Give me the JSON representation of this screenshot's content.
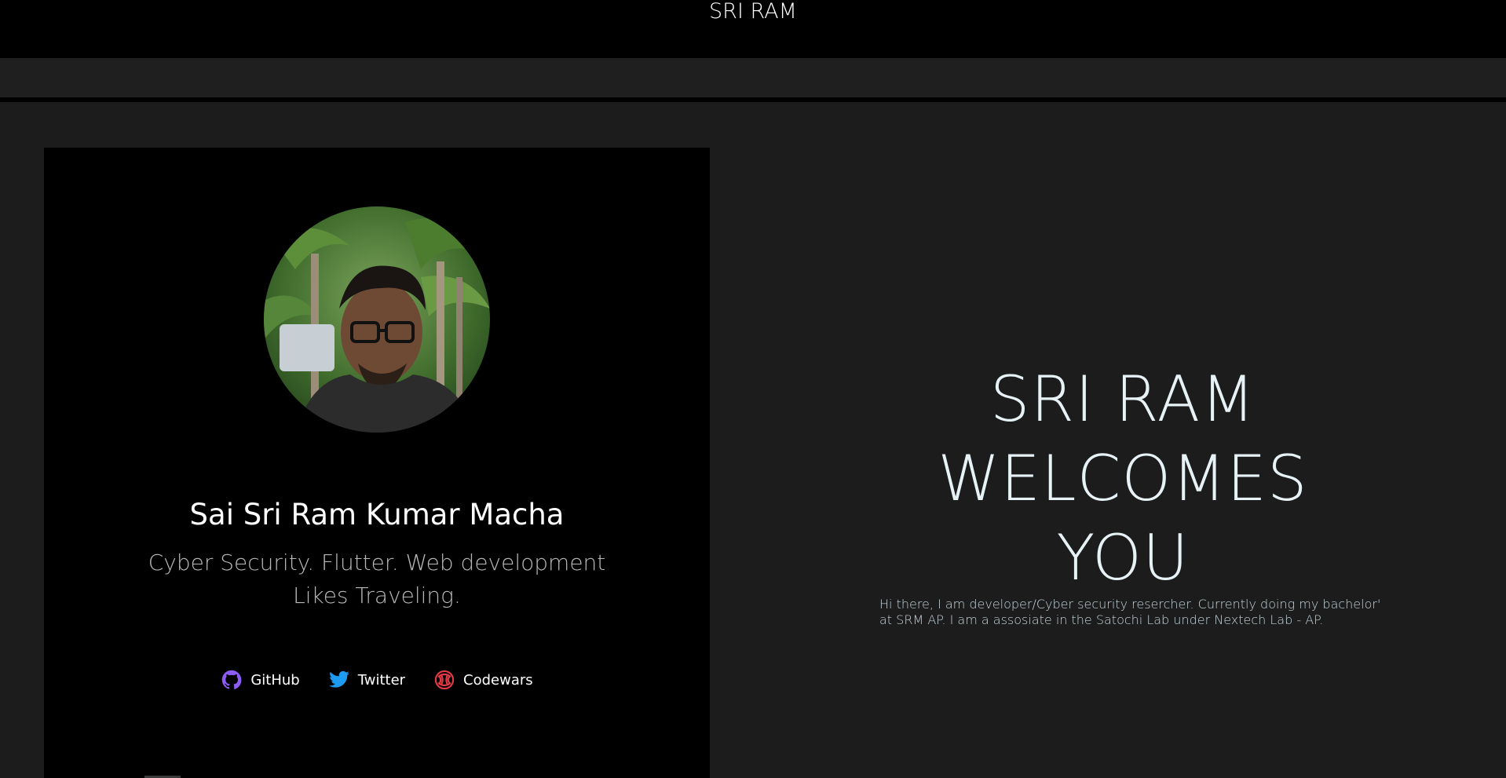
{
  "header": {
    "site_title": "SRI RAM"
  },
  "profile": {
    "name": "Sai Sri Ram Kumar Macha",
    "tagline_lines": [
      "Cyber Security. Flutter. Web development",
      "Likes Traveling."
    ],
    "avatar_icon": "profile-photo"
  },
  "social": [
    {
      "label": "GitHub",
      "icon": "github-icon",
      "color": "#8b5cf6"
    },
    {
      "label": "Twitter",
      "icon": "twitter-icon",
      "color": "#1d9bf0"
    },
    {
      "label": "Codewars",
      "icon": "codewars-icon",
      "color": "#e63946"
    }
  ],
  "hero": {
    "heading_lines": [
      "SRI RAM",
      "WELCOMES",
      "YOU"
    ],
    "intro": "Hi there, I am developer/Cyber security resercher. Currently doing my bachelor' at SRM AP. I am a assosiate in the Satochi Lab under Nextech Lab - AP."
  },
  "colors": {
    "background": "#1c1c1c",
    "card": "#000000",
    "hero_text": "#e6f2f6"
  }
}
